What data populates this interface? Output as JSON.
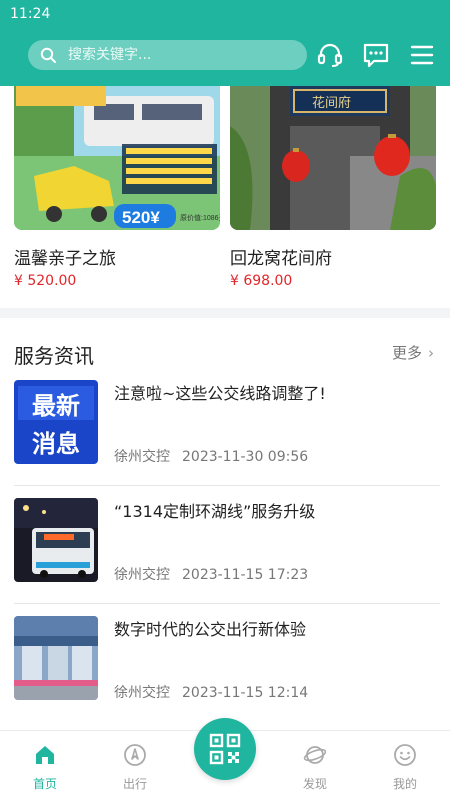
{
  "status_bar": {
    "time": "11:24"
  },
  "header": {
    "search_placeholder": "搜索关键字...",
    "icons": [
      "headset-icon",
      "message-icon",
      "menu-icon"
    ]
  },
  "products": [
    {
      "name": "温馨亲子之旅",
      "price": "¥ 520.00",
      "badge": "520¥",
      "badge_note": "原价值:1086元"
    },
    {
      "name": "回龙窝花间府",
      "price": "¥ 698.00",
      "sign": "花间府"
    }
  ],
  "news": {
    "title": "服务资讯",
    "more": "更多",
    "items": [
      {
        "title": "注意啦~这些公交线路调整了!",
        "source": "徐州交控",
        "time": "2023-11-30 09:56",
        "thumb_text": [
          "最新",
          "消息"
        ]
      },
      {
        "title": "“1314定制环湖线”服务升级",
        "source": "徐州交控",
        "time": "2023-11-15 17:23"
      },
      {
        "title": "数字时代的公交出行新体验",
        "source": "徐州交控",
        "time": "2023-11-15 12:14"
      }
    ]
  },
  "tabbar": {
    "items": [
      {
        "label": "首页",
        "icon": "home-icon",
        "active": true
      },
      {
        "label": "出行",
        "icon": "compass-icon",
        "active": false
      },
      {
        "label": "",
        "icon": "qr-code-icon",
        "active": false
      },
      {
        "label": "发现",
        "icon": "planet-icon",
        "active": false
      },
      {
        "label": "我的",
        "icon": "smiley-icon",
        "active": false
      }
    ]
  },
  "colors": {
    "primary": "#1fb59f",
    "price": "#e0262a"
  }
}
